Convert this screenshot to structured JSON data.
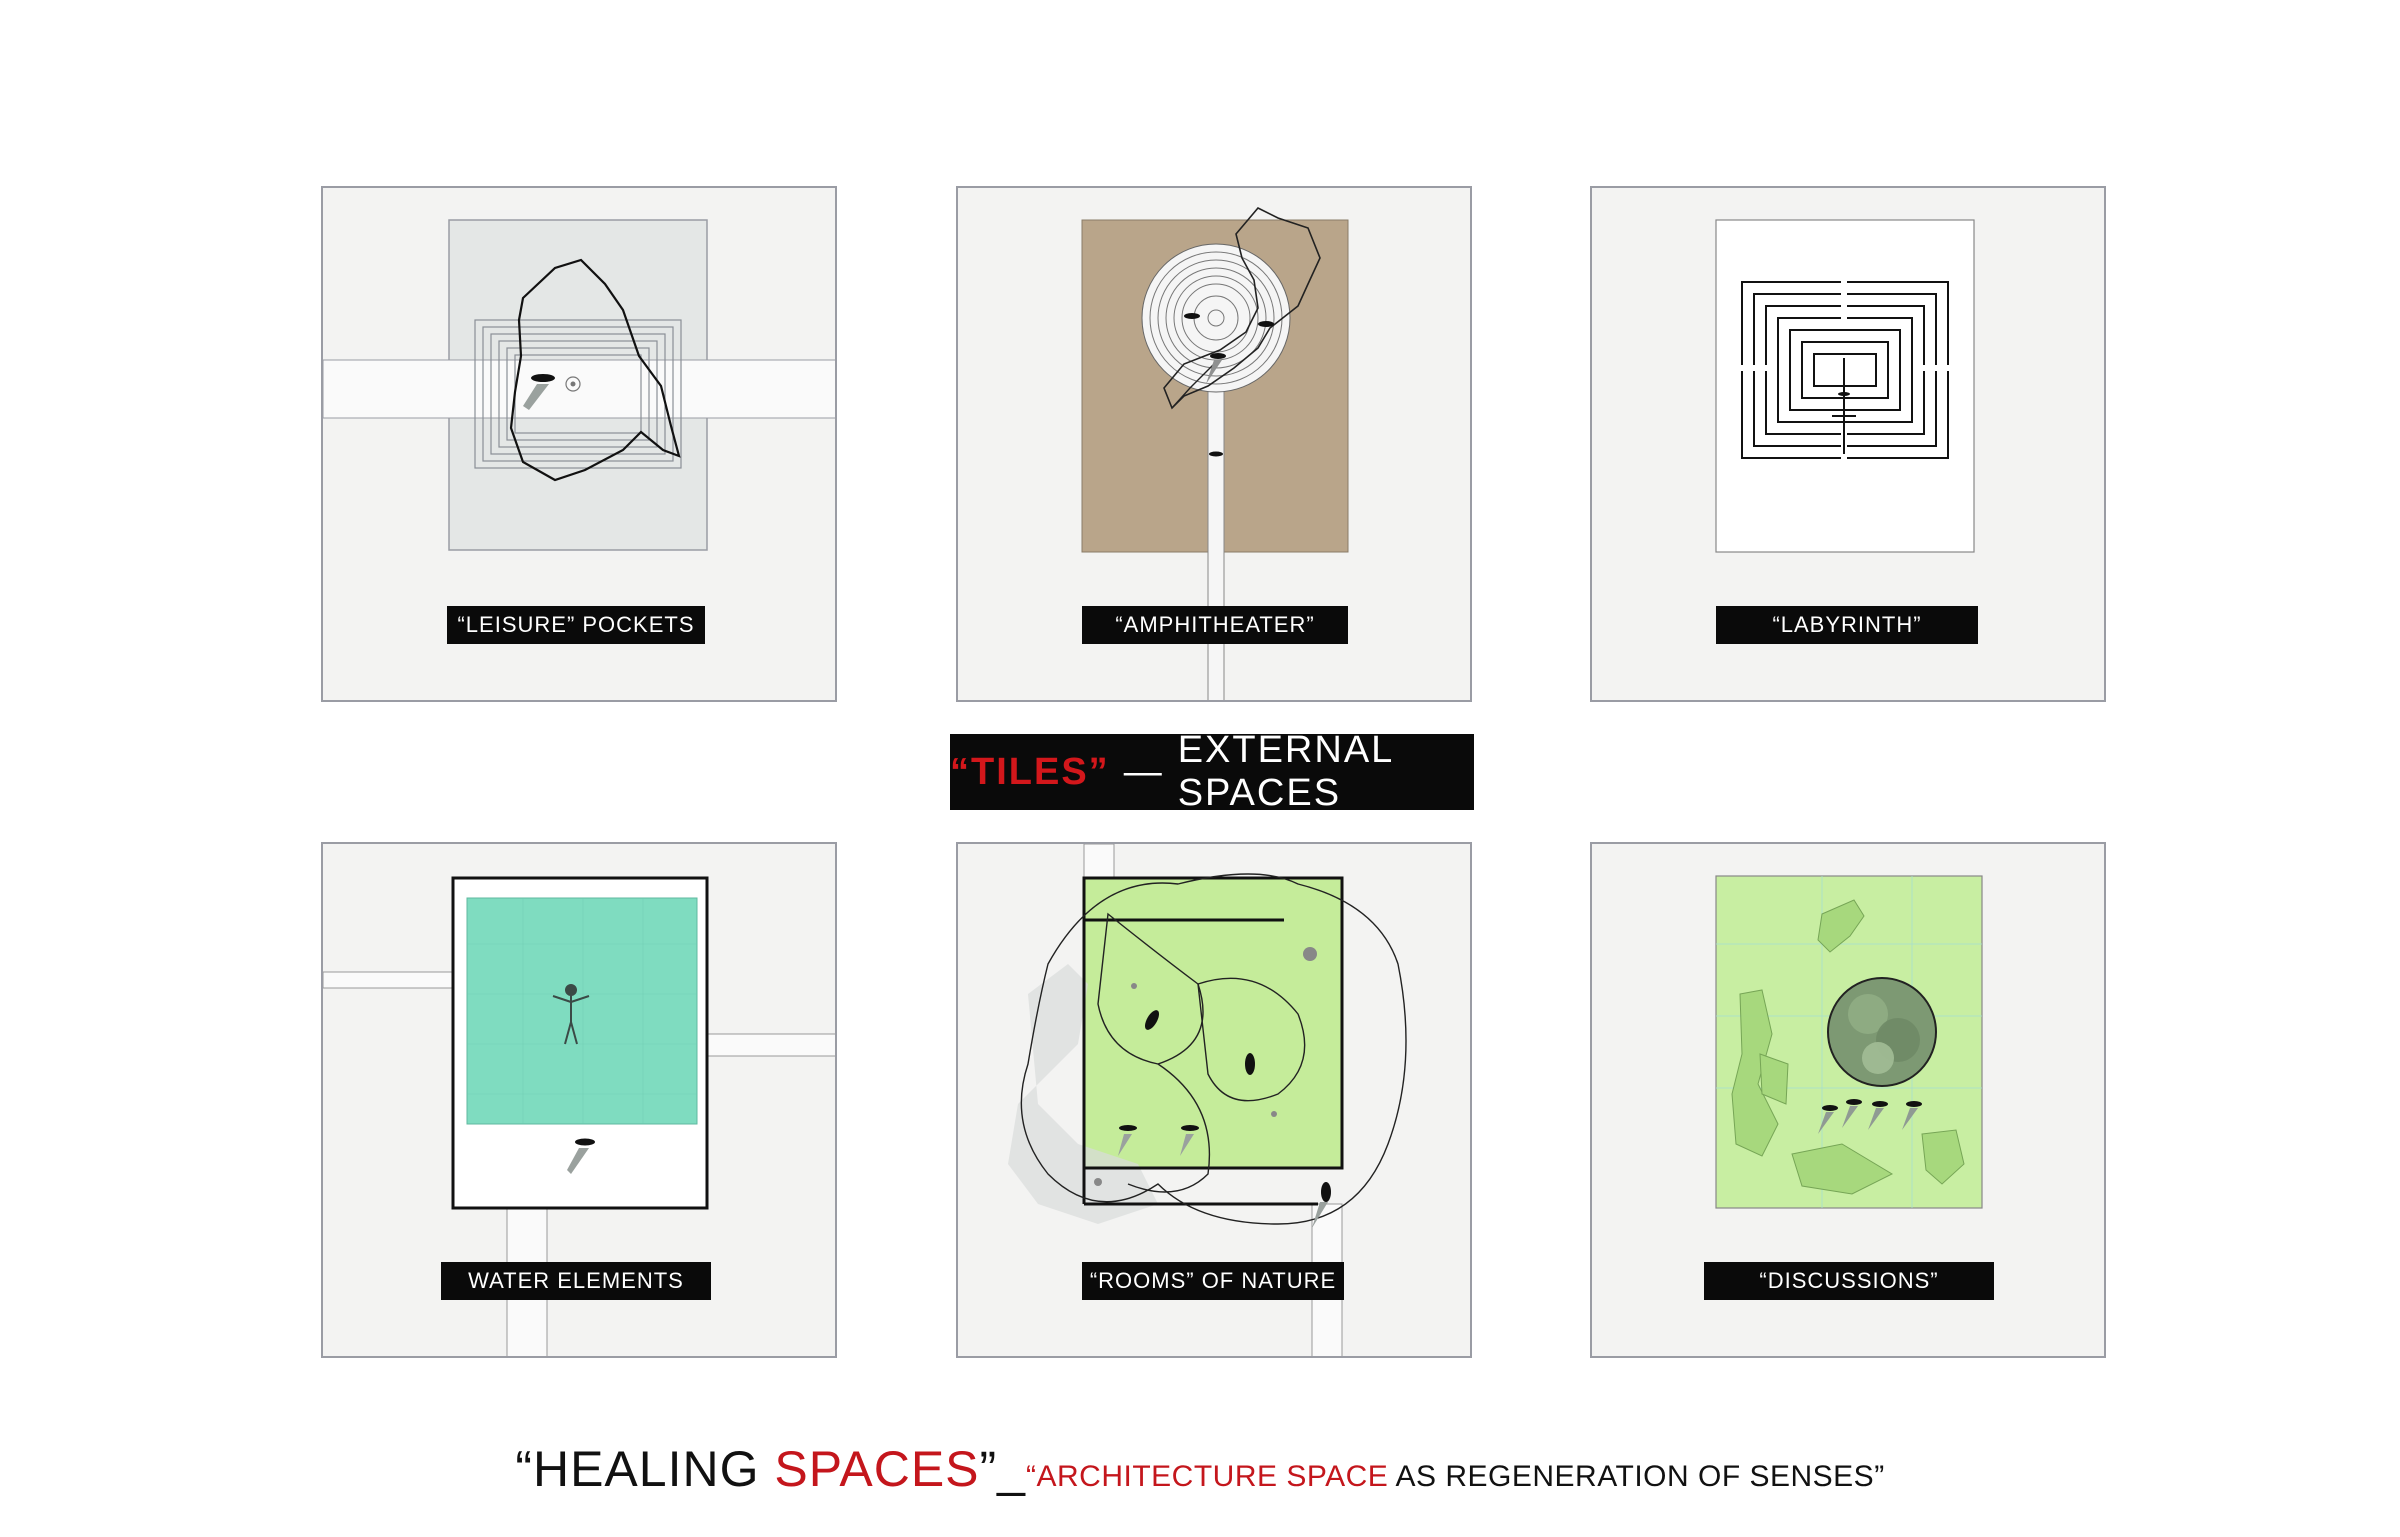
{
  "tiles": [
    {
      "id": "leisure",
      "label": "“LEISURE” POCKETS"
    },
    {
      "id": "amphi",
      "label": "“AMPHITHEATER”"
    },
    {
      "id": "labyrinth",
      "label": "“LABYRINTH”"
    },
    {
      "id": "water",
      "label": "WATER ELEMENTS"
    },
    {
      "id": "rooms",
      "label": "“ROOMS” OF NATURE"
    },
    {
      "id": "discuss",
      "label": "“DISCUSSIONS”"
    }
  ],
  "title": {
    "red": "“TILES”",
    "dash": "—",
    "rest": "EXTERNAL SPACES"
  },
  "footer": {
    "part1": "“HEALING ",
    "part1_red": "SPACES",
    "part2": "”_",
    "part3_red": "“ARCHITECTURE SPACE",
    "part4": " AS REGENERATION OF SENSES”"
  },
  "colors": {
    "accent_red": "#c4161c",
    "tile_bg": "#f3f3f2",
    "amphi_ground": "#b9a58a",
    "water": "#7fdcc0",
    "grass": "#c5ec9a"
  }
}
